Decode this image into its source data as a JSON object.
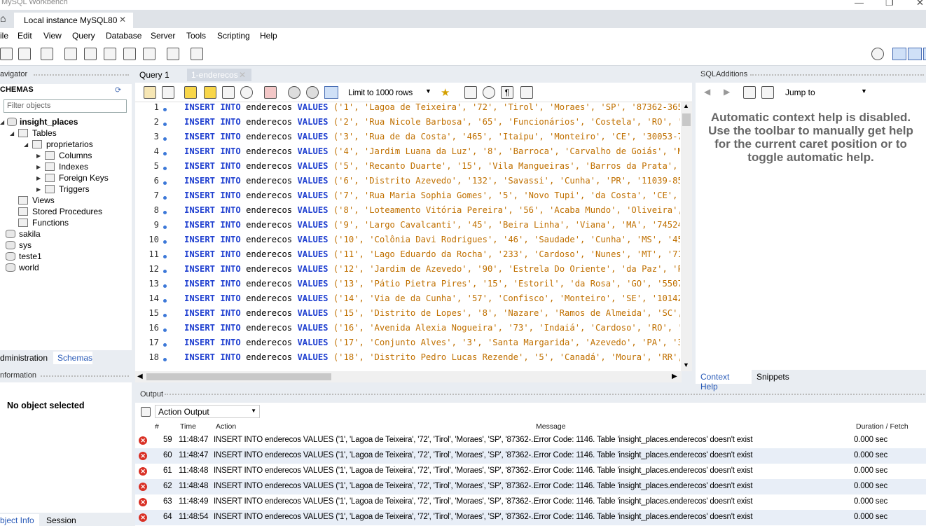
{
  "window": {
    "title": "MySQL Workbench",
    "minimize": "—",
    "restore": "❐",
    "close": "✕"
  },
  "connection_tab": {
    "label": "Local instance MySQL80",
    "close": "✕"
  },
  "menu": [
    "ile",
    "Edit",
    "View",
    "Query",
    "Database",
    "Server",
    "Tools",
    "Scripting",
    "Help"
  ],
  "navigator": {
    "header": "avigator",
    "schemas_label": "CHEMAS",
    "filter_placeholder": "Filter objects",
    "tree": [
      {
        "label": "insight_places",
        "level": 0,
        "bold": true,
        "expanded": true
      },
      {
        "label": "Tables",
        "level": 1,
        "expanded": true
      },
      {
        "label": "proprietarios",
        "level": 2,
        "expanded": true
      },
      {
        "label": "Columns",
        "level": 3
      },
      {
        "label": "Indexes",
        "level": 3
      },
      {
        "label": "Foreign Keys",
        "level": 3
      },
      {
        "label": "Triggers",
        "level": 3
      },
      {
        "label": "Views",
        "level": 1
      },
      {
        "label": "Stored Procedures",
        "level": 1
      },
      {
        "label": "Functions",
        "level": 1
      },
      {
        "label": "sakila",
        "level": 0
      },
      {
        "label": "sys",
        "level": 0
      },
      {
        "label": "teste1",
        "level": 0
      },
      {
        "label": "world",
        "level": 0
      }
    ]
  },
  "nav_tabs": {
    "admin": "dministration",
    "schemas": "Schemas"
  },
  "info": {
    "header": "nformation",
    "message": "No object selected"
  },
  "bottom_tabs": {
    "object_info": "bject Info",
    "session": "Session"
  },
  "editor_tabs": [
    {
      "label": "Query 1",
      "active": false
    },
    {
      "label": "1-enderecos",
      "active": true,
      "close": "✕"
    }
  ],
  "limit_select": "Limit to 1000 rows",
  "editor_lines": [
    {
      "n": "1",
      "vals": "('1', 'Lagoa de Teixeira', '72', 'Tirol', 'Moraes', 'SP', '87362-365');"
    },
    {
      "n": "2",
      "vals": "('2', 'Rua Nicole Barbosa', '65', 'Funcionários', 'Costela', 'RO', '9964"
    },
    {
      "n": "3",
      "vals": "('3', 'Rua de da Costa', '465', 'Itaipu', 'Monteiro', 'CE', '30053-759')"
    },
    {
      "n": "4",
      "vals": "('4', 'Jardim Luana da Luz', '8', 'Barroca', 'Carvalho de Goiás', 'MT',"
    },
    {
      "n": "5",
      "vals": "('5', 'Recanto Duarte', '15', 'Vila Mangueiras', 'Barros da Prata', 'RN'"
    },
    {
      "n": "6",
      "vals": "('6', 'Distrito Azevedo', '132', 'Savassi', 'Cunha', 'PR', '11039-854');"
    },
    {
      "n": "7",
      "vals": "('7', 'Rua Maria Sophia Gomes', '5', 'Novo Tupi', 'da Costa', 'CE', '609"
    },
    {
      "n": "8",
      "vals": "('8', 'Loteamento Vitória Pereira', '56', 'Acaba Mundo', 'Oliveira', 'SE"
    },
    {
      "n": "9",
      "vals": "('9', 'Largo Cavalcanti', '45', 'Beira Linha', 'Viana', 'MA', '74524-432"
    },
    {
      "n": "10",
      "vals": "('10', 'Colônia Davi Rodrigues', '46', 'Saudade', 'Cunha', 'MS', '45541-"
    },
    {
      "n": "11",
      "vals": "('11', 'Lago Eduardo da Rocha', '233', 'Cardoso', 'Nunes', 'MT', '71516-"
    },
    {
      "n": "12",
      "vals": "('12', 'Jardim de Azevedo', '90', 'Estrela Do Oriente', 'da Paz', 'PE',"
    },
    {
      "n": "13",
      "vals": "('13', 'Pátio Pietra Pires', '15', 'Estoril', 'da Rosa', 'GO', '55078-17"
    },
    {
      "n": "14",
      "vals": "('14', 'Via de da Cunha', '57', 'Confisco', 'Monteiro', 'SE', '10142-527"
    },
    {
      "n": "15",
      "vals": "('15', 'Distrito de Lopes', '8', 'Nazare', 'Ramos de Almeida', 'SC', '26"
    },
    {
      "n": "16",
      "vals": "('16', 'Avenida Alexia Nogueira', '73', 'Indaiá', 'Cardoso', 'RO', '1990"
    },
    {
      "n": "17",
      "vals": "('17', 'Conjunto Alves', '3', 'Santa Margarida', 'Azevedo', 'PA', '31119"
    },
    {
      "n": "18",
      "vals": "('18', 'Distrito Pedro Lucas Rezende', '5', 'Canadá', 'Moura', 'RR', '26"
    }
  ],
  "sql": {
    "insert": "INSERT",
    "into": "INTO",
    "table": "enderecos",
    "values": "VALUES"
  },
  "sql_additions": {
    "header": "SQLAdditions",
    "jump_to": "Jump to",
    "help_text": "Automatic context help is disabled. Use the toolbar to manually get help for the current caret position or to toggle automatic help."
  },
  "right_tabs": {
    "context_help": "Context Help",
    "snippets": "Snippets"
  },
  "output": {
    "header": "Output",
    "select": "Action Output",
    "columns": {
      "num": "#",
      "time": "Time",
      "action": "Action",
      "message": "Message",
      "duration": "Duration / Fetch"
    },
    "rows": [
      {
        "num": "59",
        "time": "11:48:47",
        "action": "INSERT INTO enderecos VALUES ('1', 'Lagoa de Teixeira', '72', 'Tirol', 'Moraes', 'SP', '87362-...",
        "message": "Error Code: 1146. Table 'insight_places.enderecos' doesn't exist",
        "duration": "0.000 sec"
      },
      {
        "num": "60",
        "time": "11:48:47",
        "action": "INSERT INTO enderecos VALUES ('1', 'Lagoa de Teixeira', '72', 'Tirol', 'Moraes', 'SP', '87362-...",
        "message": "Error Code: 1146. Table 'insight_places.enderecos' doesn't exist",
        "duration": "0.000 sec"
      },
      {
        "num": "61",
        "time": "11:48:48",
        "action": "INSERT INTO enderecos VALUES ('1', 'Lagoa de Teixeira', '72', 'Tirol', 'Moraes', 'SP', '87362-...",
        "message": "Error Code: 1146. Table 'insight_places.enderecos' doesn't exist",
        "duration": "0.000 sec"
      },
      {
        "num": "62",
        "time": "11:48:48",
        "action": "INSERT INTO enderecos VALUES ('1', 'Lagoa de Teixeira', '72', 'Tirol', 'Moraes', 'SP', '87362-...",
        "message": "Error Code: 1146. Table 'insight_places.enderecos' doesn't exist",
        "duration": "0.000 sec"
      },
      {
        "num": "63",
        "time": "11:48:49",
        "action": "INSERT INTO enderecos VALUES ('1', 'Lagoa de Teixeira', '72', 'Tirol', 'Moraes', 'SP', '87362-...",
        "message": "Error Code: 1146. Table 'insight_places.enderecos' doesn't exist",
        "duration": "0.000 sec"
      },
      {
        "num": "64",
        "time": "11:48:54",
        "action": "INSERT INTO enderecos VALUES ('1', 'Lagoa de Teixeira', '72', 'Tirol', 'Moraes', 'SP', '87362-...",
        "message": "Error Code: 1146. Table 'insight_places.enderecos' doesn't exist",
        "duration": "0.000 sec"
      }
    ]
  }
}
